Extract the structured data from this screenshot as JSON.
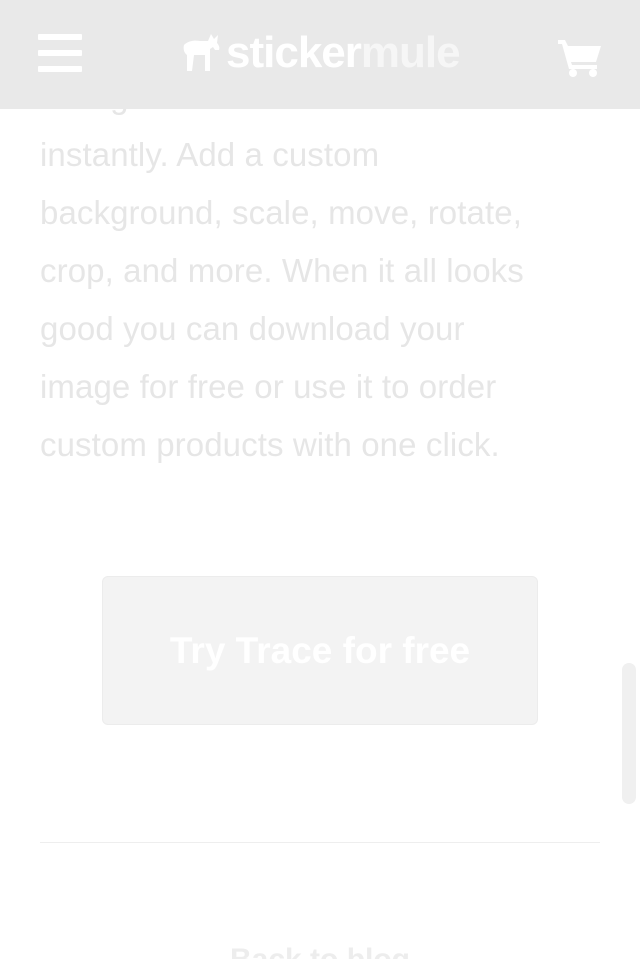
{
  "header": {
    "menu_icon": "hamburger-menu-icon",
    "logo": {
      "part1": "sticker",
      "part2": "mule"
    },
    "cart_icon": "shopping-cart-icon",
    "background": "#e9e9e9"
  },
  "article": {
    "lines": [
      "background will be removed",
      "instantly. Add a custom",
      "background, scale, move, rotate,",
      "crop, and more. When it all looks",
      "good you can download your",
      "image for free or use it to order",
      "custom products with one click."
    ],
    "text_color": "#e6e6e6"
  },
  "cta": {
    "label": "Try Trace for free",
    "background": "#f3f3f3"
  },
  "footer": {
    "back_link": "Back to blog"
  }
}
